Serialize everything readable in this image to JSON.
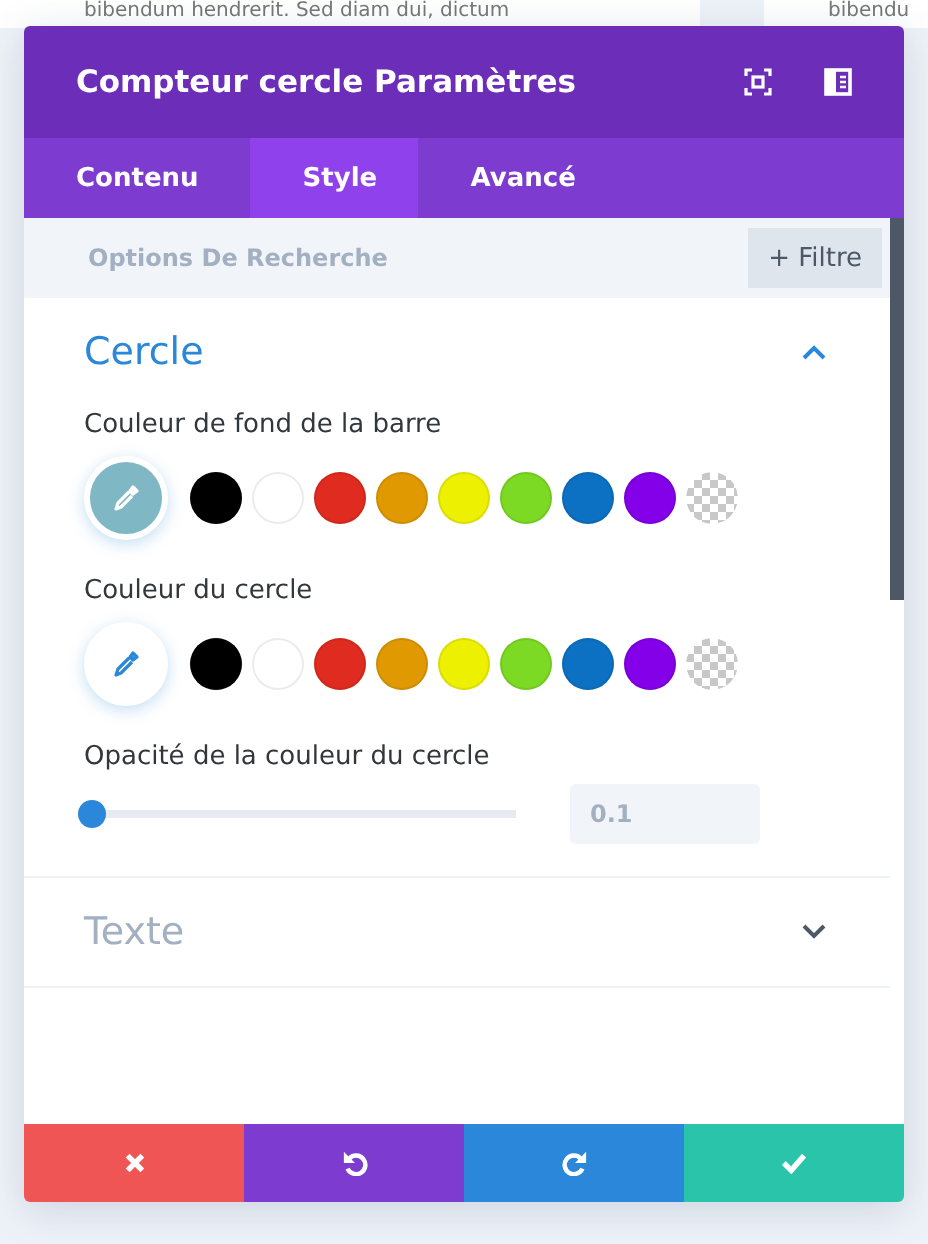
{
  "background": {
    "left_text": "bibendum hendrerit. Sed diam dui, dictum",
    "right_text": "bibendu"
  },
  "window": {
    "title": "Compteur cercle Paramètres"
  },
  "tabs": [
    {
      "label": "Contenu",
      "selected": false
    },
    {
      "label": "Style",
      "selected": true
    },
    {
      "label": "Avancé",
      "selected": false
    }
  ],
  "search": {
    "placeholder": "Options De Recherche",
    "filter_button": "+ Filtre"
  },
  "sections": [
    {
      "title": "Cercle",
      "expanded": true,
      "color_fields": [
        {
          "label": "Couleur de fond de la barre",
          "picker": {
            "color": "#7fb8c4"
          },
          "swatches": [
            {
              "color": "#000000"
            },
            {
              "color": "#ffffff"
            },
            {
              "color": "#e02b20"
            },
            {
              "color": "#e09900"
            },
            {
              "color": "#edf000"
            },
            {
              "color": "#7cda24"
            },
            {
              "color": "#0c71c3"
            },
            {
              "color": "#8300e9"
            },
            {
              "kind": "transparent"
            }
          ]
        },
        {
          "label": "Couleur du cercle",
          "swatches": [
            {
              "color": "#000000"
            },
            {
              "color": "#ffffff"
            },
            {
              "color": "#e02b20"
            },
            {
              "color": "#e09900"
            },
            {
              "color": "#edf000"
            },
            {
              "color": "#7cda24"
            },
            {
              "color": "#0c71c3"
            },
            {
              "color": "#8300e9"
            },
            {
              "kind": "transparent"
            }
          ]
        }
      ],
      "slider": {
        "label": "Opacité de la couleur du cercle",
        "level": 0.02,
        "value": "0.1"
      }
    },
    {
      "title": "Texte",
      "expanded": false
    }
  ],
  "footer_buttons": [
    {
      "kind": "cancel"
    },
    {
      "kind": "undo"
    },
    {
      "kind": "redo"
    },
    {
      "kind": "save"
    }
  ]
}
